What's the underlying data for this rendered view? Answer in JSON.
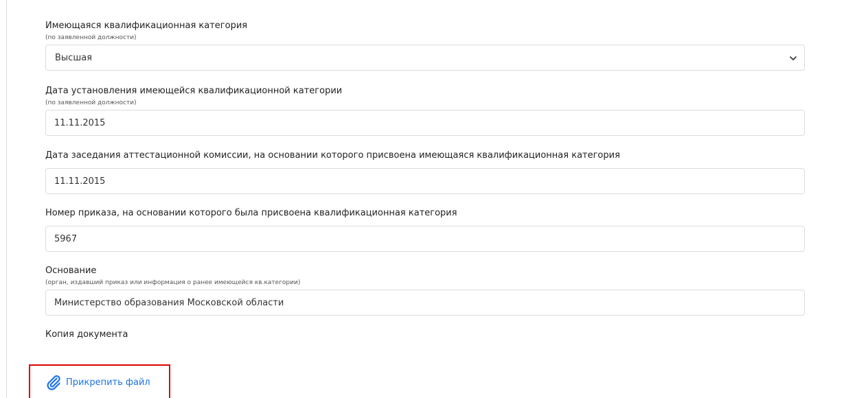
{
  "form": {
    "category": {
      "label": "Имеющаяся квалификационная категория",
      "hint": "(по заявленной должности)",
      "value": "Высшая"
    },
    "category_date": {
      "label": "Дата установления имеющейся квалификационной категории",
      "hint": "(по заявленной должности)",
      "value": "11.11.2015"
    },
    "commission_date": {
      "label": "Дата заседания аттестационной комиссии, на основании которого присвоена имеющаяся квалификационная категория",
      "value": "11.11.2015"
    },
    "order_number": {
      "label": "Номер приказа, на основании которого была присвоена квалификационная категория",
      "value": "5967"
    },
    "basis": {
      "label": "Основание",
      "hint": "(орган, издавший приказ или информация о ранее имеющейся кв.категории)",
      "value": "Министерство образования Московской области"
    },
    "document_copy": {
      "label": "Копия документа"
    },
    "attach": {
      "label": "Прикрепить файл",
      "icon": "paperclip-icon"
    }
  },
  "colors": {
    "accent": "#1a73e8",
    "highlight": "#e00000",
    "border": "#dcdcdc"
  }
}
